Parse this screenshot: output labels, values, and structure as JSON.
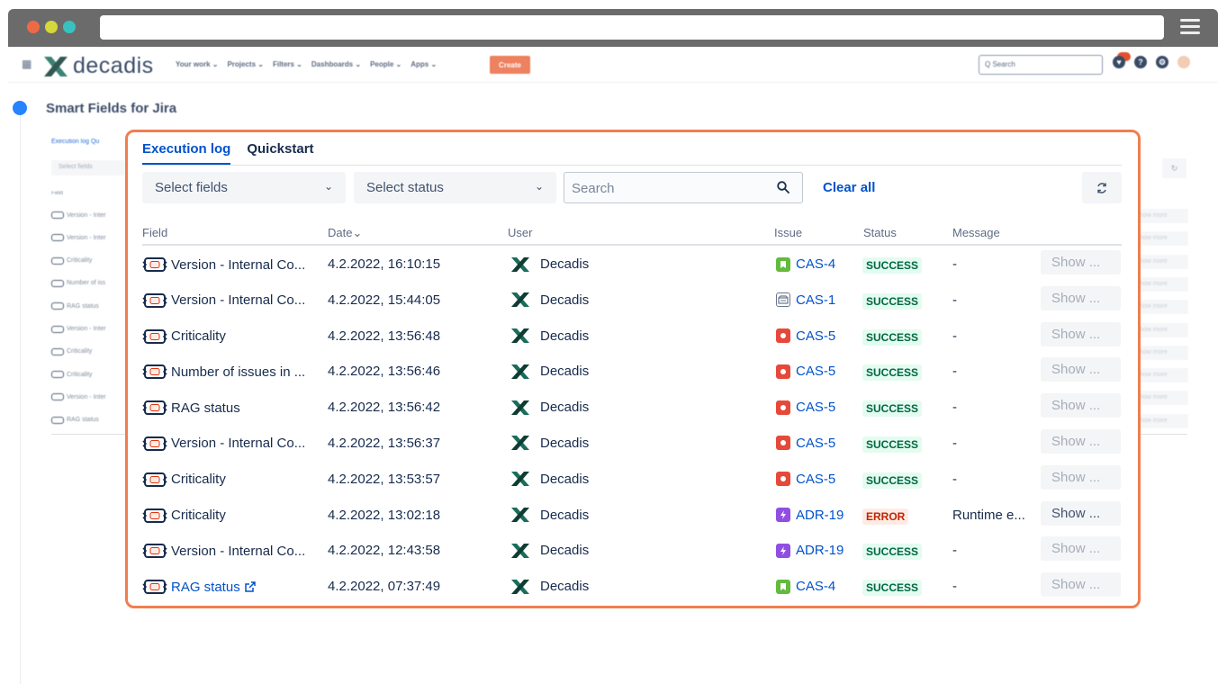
{
  "nav": {
    "brand": "decadis",
    "links": [
      "Your work ⌄",
      "Projects ⌄",
      "Filters ⌄",
      "Dashboards ⌄",
      "People ⌄",
      "Apps ⌄"
    ],
    "create_label": "Create",
    "search_placeholder": "Q Search",
    "notification_count": ""
  },
  "page": {
    "title": "Smart Fields for Jira"
  },
  "background": {
    "tab_label": "Execution log  Qu",
    "select_fields": "Select fields",
    "field_header": "Field",
    "rows": [
      "Version - Inter",
      "Version - Inter",
      "Criticality",
      "Number of iss",
      "RAG status",
      "Version - Inter",
      "Criticality",
      "Criticality",
      "Version - Inter",
      "RAG status"
    ],
    "show_more": "how more"
  },
  "panel": {
    "tabs": [
      {
        "label": "Execution log",
        "active": true
      },
      {
        "label": "Quickstart",
        "active": false
      }
    ],
    "filters": {
      "select_fields": "Select fields",
      "select_status": "Select status",
      "search_placeholder": "Search",
      "clear_all": "Clear all"
    },
    "columns": {
      "field": "Field",
      "date": "Date⌄",
      "user": "User",
      "issue": "Issue",
      "status": "Status",
      "message": "Message"
    },
    "rows": [
      {
        "field": "Version - Internal Co...",
        "date": "4.2.2022, 16:10:15",
        "user": "Decadis",
        "issue": "CAS-4",
        "issue_type": "story",
        "status": "SUCCESS",
        "message": "-",
        "show": "Show ...",
        "show_enabled": false,
        "field_link": false
      },
      {
        "field": "Version - Internal Co...",
        "date": "4.2.2022, 15:44:05",
        "user": "Decadis",
        "issue": "CAS-1",
        "issue_type": "task",
        "status": "SUCCESS",
        "message": "-",
        "show": "Show ...",
        "show_enabled": false,
        "field_link": false
      },
      {
        "field": "Criticality",
        "date": "4.2.2022, 13:56:48",
        "user": "Decadis",
        "issue": "CAS-5",
        "issue_type": "bug",
        "status": "SUCCESS",
        "message": "-",
        "show": "Show ...",
        "show_enabled": false,
        "field_link": false
      },
      {
        "field": "Number of issues in ...",
        "date": "4.2.2022, 13:56:46",
        "user": "Decadis",
        "issue": "CAS-5",
        "issue_type": "bug",
        "status": "SUCCESS",
        "message": "-",
        "show": "Show ...",
        "show_enabled": false,
        "field_link": false
      },
      {
        "field": "RAG status",
        "date": "4.2.2022, 13:56:42",
        "user": "Decadis",
        "issue": "CAS-5",
        "issue_type": "bug",
        "status": "SUCCESS",
        "message": "-",
        "show": "Show ...",
        "show_enabled": false,
        "field_link": false
      },
      {
        "field": "Version - Internal Co...",
        "date": "4.2.2022, 13:56:37",
        "user": "Decadis",
        "issue": "CAS-5",
        "issue_type": "bug",
        "status": "SUCCESS",
        "message": "-",
        "show": "Show ...",
        "show_enabled": false,
        "field_link": false
      },
      {
        "field": "Criticality",
        "date": "4.2.2022, 13:53:57",
        "user": "Decadis",
        "issue": "CAS-5",
        "issue_type": "bug",
        "status": "SUCCESS",
        "message": "-",
        "show": "Show ...",
        "show_enabled": false,
        "field_link": false
      },
      {
        "field": "Criticality",
        "date": "4.2.2022, 13:02:18",
        "user": "Decadis",
        "issue": "ADR-19",
        "issue_type": "epic",
        "status": "ERROR",
        "message": "Runtime e...",
        "show": "Show ...",
        "show_enabled": true,
        "field_link": false
      },
      {
        "field": "Version - Internal Co...",
        "date": "4.2.2022, 12:43:58",
        "user": "Decadis",
        "issue": "ADR-19",
        "issue_type": "epic",
        "status": "SUCCESS",
        "message": "-",
        "show": "Show ...",
        "show_enabled": false,
        "field_link": false
      },
      {
        "field": "RAG status",
        "date": "4.2.2022, 07:37:49",
        "user": "Decadis",
        "issue": "CAS-4",
        "issue_type": "story",
        "status": "SUCCESS",
        "message": "-",
        "show": "Show ...",
        "show_enabled": false,
        "field_link": true
      }
    ]
  },
  "colors": {
    "accent": "#0052cc",
    "highlight_border": "#f07e4f",
    "create_button": "#ec6c44",
    "success_bg": "#e3fcef",
    "success_text": "#006644",
    "error_bg": "#ffebe6",
    "error_text": "#bf2600"
  },
  "icons": {
    "smart_field": "smart-field-icon",
    "user_avatar": "decadis-logo-icon",
    "story": "story-icon",
    "task": "task-icon",
    "bug": "bug-icon",
    "epic": "epic-icon",
    "search": "search-icon",
    "refresh": "refresh-icon",
    "external_link": "external-link-icon"
  }
}
